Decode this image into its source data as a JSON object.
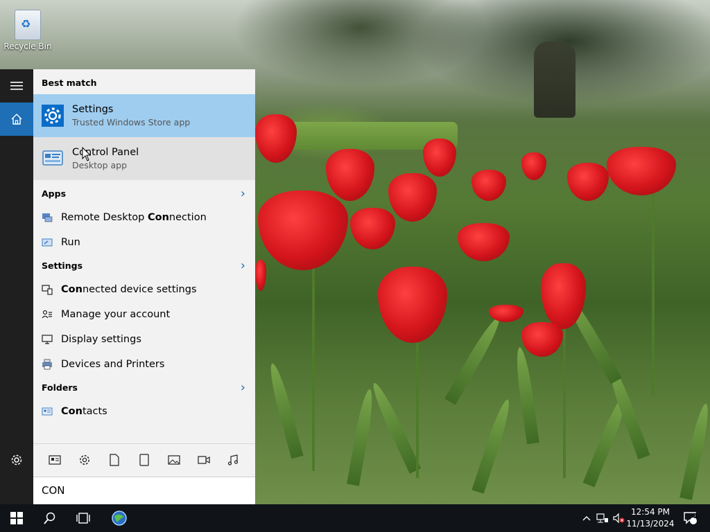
{
  "desktop": {
    "icons": [
      {
        "label": "Recycle Bin",
        "icon": "recycle-bin-icon"
      }
    ]
  },
  "start_rail": {
    "menu_icon": "hamburger-menu-icon",
    "home_icon": "home-icon",
    "settings_icon": "gear-icon",
    "accent": "#1e6fb5",
    "background": "#1f1f1f"
  },
  "search_panel": {
    "best_match": {
      "title": "Best match",
      "items": [
        {
          "name": "Settings",
          "subtitle": "Trusted Windows Store app",
          "icon": "settings-gear-icon",
          "state": "selected"
        },
        {
          "name": "Control Panel",
          "subtitle": "Desktop app",
          "icon": "control-panel-icon",
          "state": "hover"
        }
      ]
    },
    "apps": {
      "title": "Apps",
      "items": [
        {
          "prefix": "Remote Desktop ",
          "match": "Con",
          "suffix": "nection",
          "icon": "remote-desktop-icon"
        },
        {
          "prefix": "Run",
          "match": "",
          "suffix": "",
          "icon": "run-icon"
        }
      ]
    },
    "settings": {
      "title": "Settings",
      "items": [
        {
          "prefix": "",
          "match": "Con",
          "suffix": "nected device settings",
          "icon": "connected-devices-icon"
        },
        {
          "prefix": "Manage your account",
          "match": "",
          "suffix": "",
          "icon": "account-icon"
        },
        {
          "prefix": "Display settings",
          "match": "",
          "suffix": "",
          "icon": "display-icon"
        },
        {
          "prefix": "Devices and Printers",
          "match": "",
          "suffix": "",
          "icon": "printer-icon"
        }
      ]
    },
    "folders": {
      "title": "Folders",
      "items": [
        {
          "prefix": "",
          "match": "Con",
          "suffix": "tacts",
          "icon": "contacts-icon"
        }
      ]
    },
    "filters": [
      "app-filter-icon",
      "settings-filter-icon",
      "documents-filter-icon",
      "tablet-filter-icon",
      "photos-filter-icon",
      "videos-filter-icon",
      "music-filter-icon"
    ],
    "search_query": "CON",
    "colors": {
      "selected": "#9fcdf0",
      "hover": "#e1e1e1",
      "panel": "#f2f2f2"
    }
  },
  "taskbar": {
    "time": "12:54 PM",
    "date": "11/13/2024",
    "notification_count": "1",
    "background": "#101418"
  }
}
